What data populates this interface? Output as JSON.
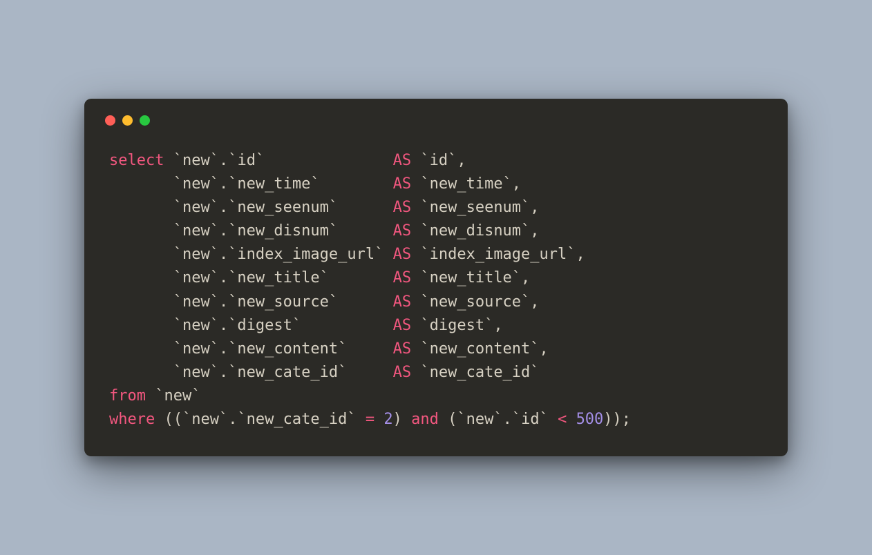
{
  "colors": {
    "background": "#aab6c5",
    "window_bg": "#2b2a26",
    "text": "#d6d0c2",
    "keyword": "#f2577f",
    "number": "#a38ee6",
    "traffic_red": "#ff5f57",
    "traffic_yellow": "#febc2e",
    "traffic_green": "#28c840"
  },
  "code": {
    "select": "select",
    "as": "AS",
    "from": "from",
    "where": "where",
    "and": "and",
    "eq": "=",
    "lt": "<",
    "columns": [
      {
        "table": "`new`",
        "col": "`id`",
        "pad": "              ",
        "alias": "`id`",
        "comma": ","
      },
      {
        "table": "`new`",
        "col": "`new_time`",
        "pad": "        ",
        "alias": "`new_time`",
        "comma": ","
      },
      {
        "table": "`new`",
        "col": "`new_seenum`",
        "pad": "      ",
        "alias": "`new_seenum`",
        "comma": ","
      },
      {
        "table": "`new`",
        "col": "`new_disnum`",
        "pad": "      ",
        "alias": "`new_disnum`",
        "comma": ","
      },
      {
        "table": "`new`",
        "col": "`index_image_url`",
        "pad": " ",
        "alias": "`index_image_url`",
        "comma": ","
      },
      {
        "table": "`new`",
        "col": "`new_title`",
        "pad": "       ",
        "alias": "`new_title`",
        "comma": ","
      },
      {
        "table": "`new`",
        "col": "`new_source`",
        "pad": "      ",
        "alias": "`new_source`",
        "comma": ","
      },
      {
        "table": "`new`",
        "col": "`digest`",
        "pad": "          ",
        "alias": "`digest`",
        "comma": ","
      },
      {
        "table": "`new`",
        "col": "`new_content`",
        "pad": "     ",
        "alias": "`new_content`",
        "comma": ","
      },
      {
        "table": "`new`",
        "col": "`new_cate_id`",
        "pad": "     ",
        "alias": "`new_cate_id`",
        "comma": ""
      }
    ],
    "from_table": "`new`",
    "where_clause": {
      "left_table": "`new`",
      "left_col": "`new_cate_id`",
      "left_val": "2",
      "right_table": "`new`",
      "right_col": "`id`",
      "right_val": "500"
    },
    "indent_first": " ",
    "indent_rest": "       ",
    "dot": "."
  }
}
